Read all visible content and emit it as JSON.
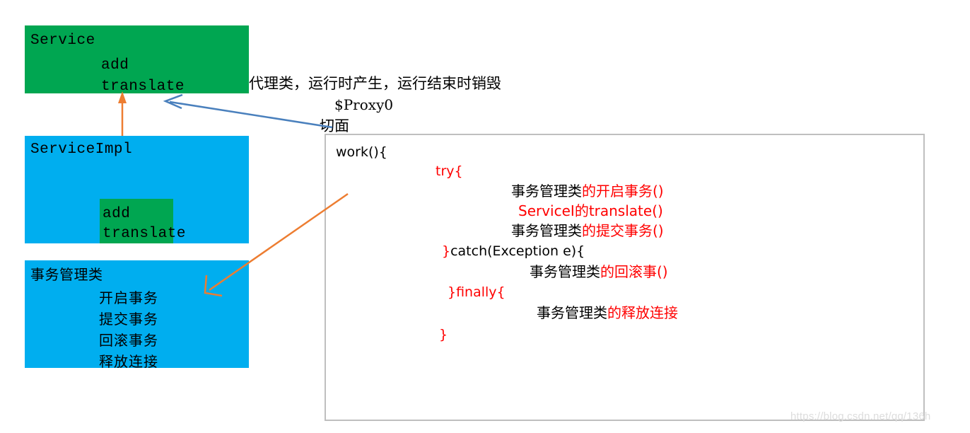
{
  "boxes": {
    "service": {
      "title": "Service",
      "methods": [
        "add",
        "translate"
      ],
      "color": "#00A651"
    },
    "service_impl": {
      "title": "ServiceImpl",
      "methods": [
        "add",
        "translate"
      ],
      "color": "#00AEEF",
      "inner_block_color": "#00A651"
    },
    "tx_manager": {
      "title": "事务管理类",
      "methods": [
        "开启事务",
        "提交事务",
        "回滚事务",
        "释放连接"
      ],
      "color": "#00AEEF"
    }
  },
  "notes": {
    "line1": "代理类，运行时产生，运行结束时销毁",
    "line2": "$Proxy0",
    "line3": "切面"
  },
  "code": {
    "l1": "work(){",
    "l2": "try{",
    "l3_black": "事务管理类",
    "l3_red": "的开启事务()",
    "l4": "ServiceI的translate()",
    "l5_black": "事务管理类",
    "l5_red": "的提交事务()",
    "l6_red": "}",
    "l6_black": "catch(Exception e){",
    "l7_black": "事务管理类",
    "l7_red": "的回滚事()",
    "l8": "}finally{",
    "l9_black": "事务管理类",
    "l9_red": "的释放连接",
    "l10": "}"
  },
  "colors": {
    "green": "#00A651",
    "blue": "#00AEEF",
    "arrow_orange": "#ED7D31",
    "arrow_blue": "#4A80BD",
    "code_red": "#FF0000",
    "panel_border": "#BFBFBF"
  },
  "watermark": "https://blog.csdn.net/qq/136h"
}
